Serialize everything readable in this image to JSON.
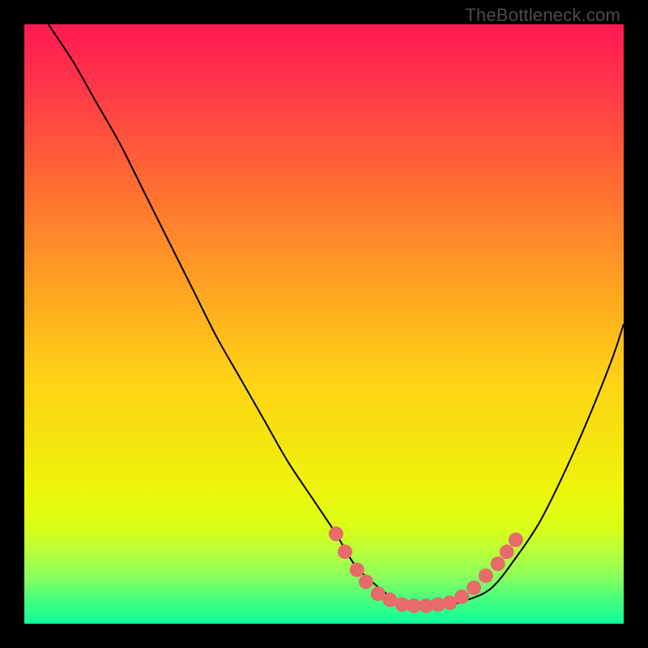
{
  "watermark": "TheBottleneck.com",
  "chart_data": {
    "type": "line",
    "title": "",
    "xlabel": "",
    "ylabel": "",
    "xlim": [
      0,
      100
    ],
    "ylim": [
      0,
      100
    ],
    "series": [
      {
        "name": "bottleneck-curve",
        "x": [
          4,
          8,
          12,
          16,
          20,
          24,
          28,
          32,
          36,
          40,
          44,
          48,
          52,
          55,
          58,
          62,
          66,
          70,
          74,
          78,
          82,
          86,
          90,
          94,
          98,
          100
        ],
        "y": [
          100,
          94,
          87,
          80,
          72,
          64,
          56,
          48,
          41,
          34,
          27,
          21,
          15,
          10,
          7,
          4,
          3,
          3,
          4,
          6,
          11,
          17,
          25,
          34,
          44,
          50
        ]
      }
    ],
    "markers": {
      "name": "highlight-dots",
      "color": "#e76b6b",
      "points": [
        {
          "x": 52,
          "y": 15
        },
        {
          "x": 53.5,
          "y": 12
        },
        {
          "x": 55.5,
          "y": 9
        },
        {
          "x": 57,
          "y": 7
        },
        {
          "x": 59,
          "y": 5
        },
        {
          "x": 61,
          "y": 4
        },
        {
          "x": 63,
          "y": 3.2
        },
        {
          "x": 65,
          "y": 3
        },
        {
          "x": 67,
          "y": 3
        },
        {
          "x": 69,
          "y": 3.2
        },
        {
          "x": 71,
          "y": 3.5
        },
        {
          "x": 73,
          "y": 4.5
        },
        {
          "x": 75,
          "y": 6
        },
        {
          "x": 77,
          "y": 8
        },
        {
          "x": 79,
          "y": 10
        },
        {
          "x": 80.5,
          "y": 12
        },
        {
          "x": 82,
          "y": 14
        }
      ]
    },
    "gradient_stops": [
      {
        "pos": 0,
        "color": "#ff1a52"
      },
      {
        "pos": 50,
        "color": "#ffb01e"
      },
      {
        "pos": 80,
        "color": "#eef60a"
      },
      {
        "pos": 100,
        "color": "#10ff9a"
      }
    ]
  }
}
